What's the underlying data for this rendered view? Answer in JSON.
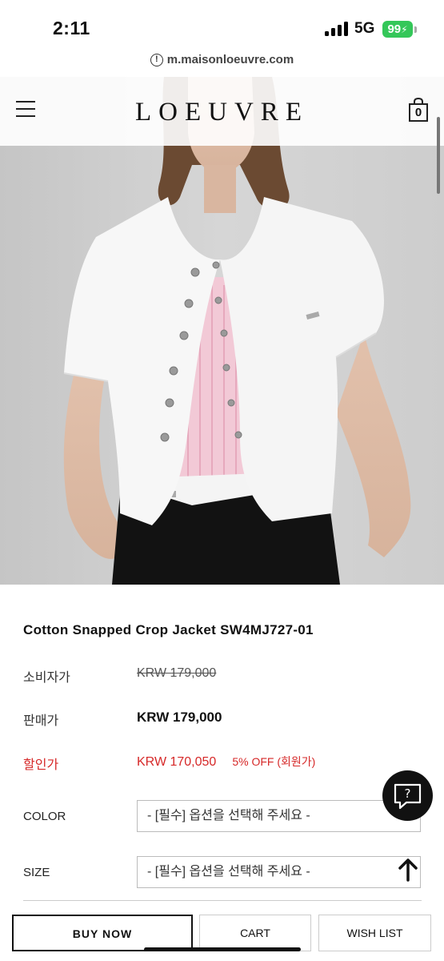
{
  "status_bar": {
    "time": "2:11",
    "network": "5G",
    "battery": "99"
  },
  "browser": {
    "url": "m.maisonloeuvre.com"
  },
  "header": {
    "logo": "LOEUVRE",
    "cart_count": "0"
  },
  "product": {
    "title": "Cotton Snapped Crop Jacket SW4MJ727-01",
    "consumer_price_label": "소비자가",
    "consumer_price": "KRW 179,000",
    "sale_price_label": "판매가",
    "sale_price": "KRW 179,000",
    "discount_label": "할인가",
    "discount_price": "KRW 170,050",
    "discount_note": "5% OFF (회원가)"
  },
  "options": {
    "color_label": "COLOR",
    "color_value": "- [필수] 옵션을 선택해 주세요 -",
    "size_label": "SIZE",
    "size_value": "- [필수] 옵션을 선택해 주세요 -"
  },
  "actions": {
    "buy_now": "BUY NOW",
    "cart": "CART",
    "wish_list": "WISH LIST"
  },
  "chat": {
    "symbol": "?"
  },
  "colors": {
    "discount_red": "#d62828",
    "battery_green": "#34c759"
  },
  "icons": [
    "info-icon",
    "menu-icon",
    "shopping-bag-icon",
    "chat-icon",
    "scroll-up-arrow-icon",
    "signal-icon",
    "battery-icon"
  ]
}
